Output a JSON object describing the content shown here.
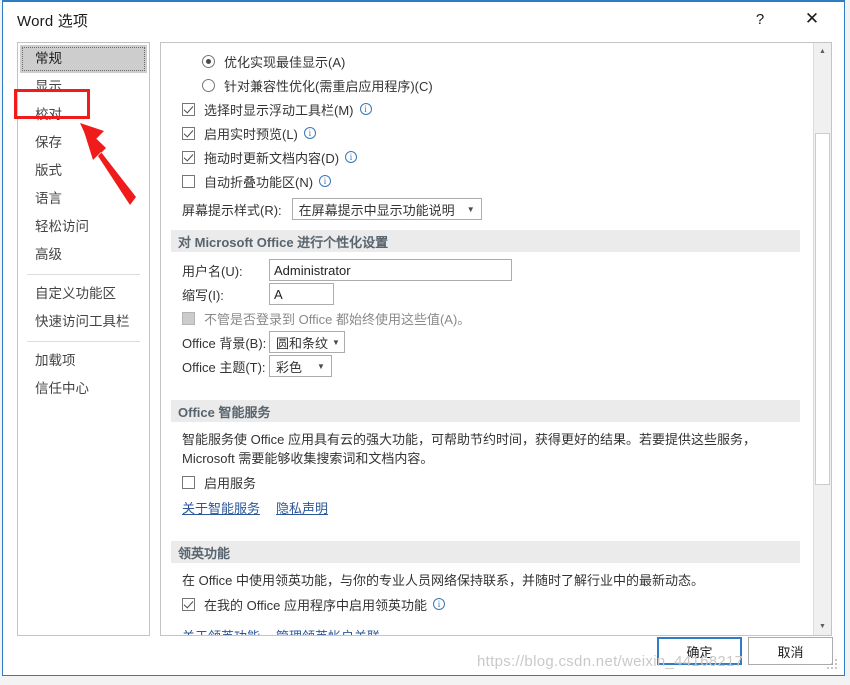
{
  "window": {
    "title": "Word 选项",
    "help_icon": "question-mark-icon",
    "close_icon": "close-icon",
    "help_label": "?",
    "close_label": "✕"
  },
  "sidebar": {
    "items": [
      {
        "label": "常规",
        "selected": true
      },
      {
        "label": "显示",
        "selected": false
      },
      {
        "label": "校对",
        "selected": false
      },
      {
        "label": "保存",
        "selected": false
      },
      {
        "label": "版式",
        "selected": false
      },
      {
        "label": "语言",
        "selected": false
      },
      {
        "label": "轻松访问",
        "selected": false
      },
      {
        "label": "高级",
        "selected": false
      },
      {
        "label": "自定义功能区",
        "selected": false
      },
      {
        "label": "快速访问工具栏",
        "selected": false
      },
      {
        "label": "加载项",
        "selected": false
      },
      {
        "label": "信任中心",
        "selected": false
      }
    ]
  },
  "main": {
    "ui_options": {
      "radios": [
        {
          "label": "优化实现最佳显示(A)",
          "accesskey": "A",
          "checked": true
        },
        {
          "label": "针对兼容性优化(需重启应用程序)(C)",
          "accesskey": "C",
          "checked": false
        }
      ],
      "checkboxes": [
        {
          "label": "选择时显示浮动工具栏(M)",
          "checked": true,
          "info": true
        },
        {
          "label": "启用实时预览(L)",
          "checked": true,
          "info": true
        },
        {
          "label": "拖动时更新文档内容(D)",
          "checked": true,
          "info": true
        },
        {
          "label": "自动折叠功能区(N)",
          "checked": false,
          "info": true
        }
      ],
      "screentip": {
        "label": "屏幕提示样式(R):",
        "value": "在屏幕提示中显示功能说明"
      }
    },
    "personalize": {
      "header": "对 Microsoft Office 进行个性化设置",
      "username_label": "用户名(U):",
      "username_value": "Administrator",
      "initials_label": "缩写(I):",
      "initials_value": "A",
      "always_use_label": "不管是否登录到 Office 都始终使用这些值(A)。",
      "always_use_checked": false,
      "always_use_disabled": true,
      "background_label": "Office 背景(B):",
      "background_value": "圆和条纹",
      "theme_label": "Office 主题(T):",
      "theme_value": "彩色"
    },
    "smart_services": {
      "header": "Office 智能服务",
      "description": "智能服务使 Office 应用具有云的强大功能，可帮助节约时间，获得更好的结果。若要提供这些服务，Microsoft 需要能够收集搜索词和文档内容。",
      "enable_label": "启用服务",
      "enable_checked": false,
      "links": [
        "关于智能服务",
        "隐私声明"
      ]
    },
    "linkedin": {
      "header": "领英功能",
      "description": "在 Office 中使用领英功能，与你的专业人员网络保持联系，并随时了解行业中的最新动态。",
      "enable_label": "在我的 Office 应用程序中启用领英功能",
      "enable_checked": true,
      "links": [
        "关于领英功能",
        "管理领英帐户关联"
      ]
    }
  },
  "scrollbar": {
    "up_arrow": "▲",
    "down_arrow": "▼"
  },
  "footer": {
    "ok_label": "确定",
    "cancel_label": "取消"
  },
  "annotations": {
    "highlight_color": "#f01b1b",
    "highlight_target": "校对",
    "watermark": "https://blog.csdn.net/weixin_44168217"
  }
}
